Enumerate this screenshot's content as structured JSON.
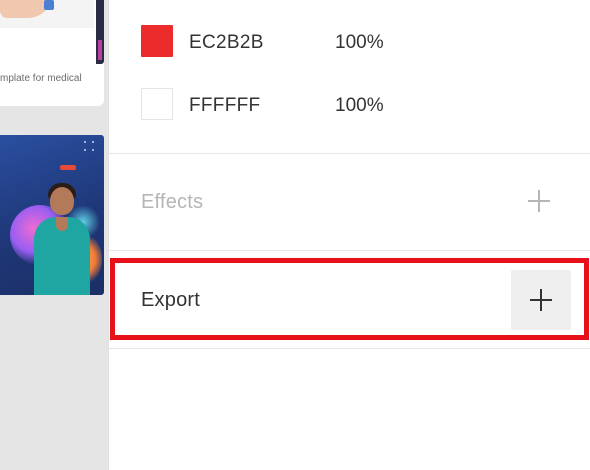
{
  "left_thumbnails": {
    "card1_caption": "mplate for medical"
  },
  "fills": [
    {
      "hex": "EC2B2B",
      "opacity": "100%",
      "color": "#ec2b2b"
    },
    {
      "hex": "FFFFFF",
      "opacity": "100%",
      "color": "#ffffff"
    }
  ],
  "effects": {
    "label": "Effects",
    "add_icon": "plus-icon"
  },
  "export": {
    "label": "Export",
    "add_icon": "plus-icon"
  },
  "colors": {
    "highlight": "#e8111a",
    "effects_text": "#b5b5b5",
    "export_text": "#333333"
  }
}
